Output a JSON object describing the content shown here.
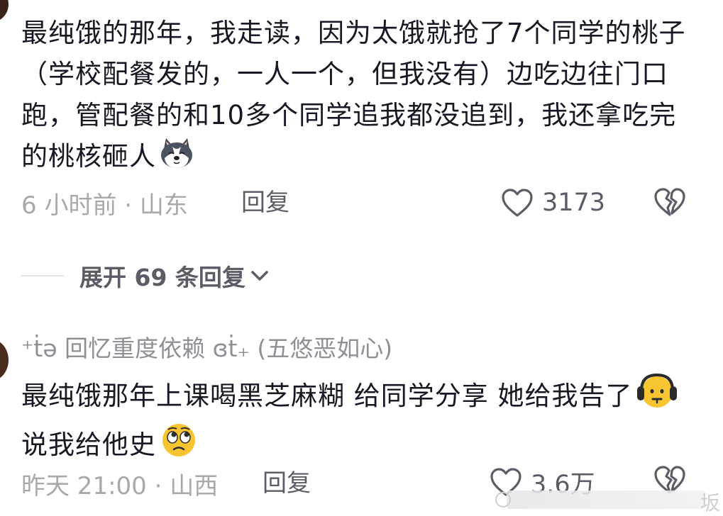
{
  "top_fragment": "·",
  "comment1": {
    "text": "最纯饿的那年，我走读，因为太饿就抢了7个同学的桃子（学校配餐发的，一人一个，但我没有）边吃边往门口跑，管配餐的和10多个同学追我都没追到，我还拿吃完的桃核砸人",
    "emoji": "husky-dog-emoji",
    "time_location": "6 小时前 · 山东",
    "reply_label": "回复",
    "like_count": "3173"
  },
  "expand_replies": {
    "label": "展开 69 条回复"
  },
  "comment2": {
    "username": "⁺ṫə 回忆重度依赖 ɞṫ₊ (五悠恶如心)",
    "text_part1": "最纯饿那年上课喝黑芝麻糊 给同学分享 她给我告了",
    "emoji1": "headphones-face-emoji",
    "text_part2": " 说我给他史",
    "emoji2": "rolling-eyes-face-emoji",
    "time_location": "昨天 21:00 · 山西",
    "reply_label": "回复",
    "like_count": "3.6万"
  },
  "watermark": {
    "text": "坂"
  },
  "colors": {
    "primary_text": "#161823",
    "secondary_text": "#a8a9ad",
    "action_text": "#5c5c66",
    "divider": "#e3e3e6"
  }
}
